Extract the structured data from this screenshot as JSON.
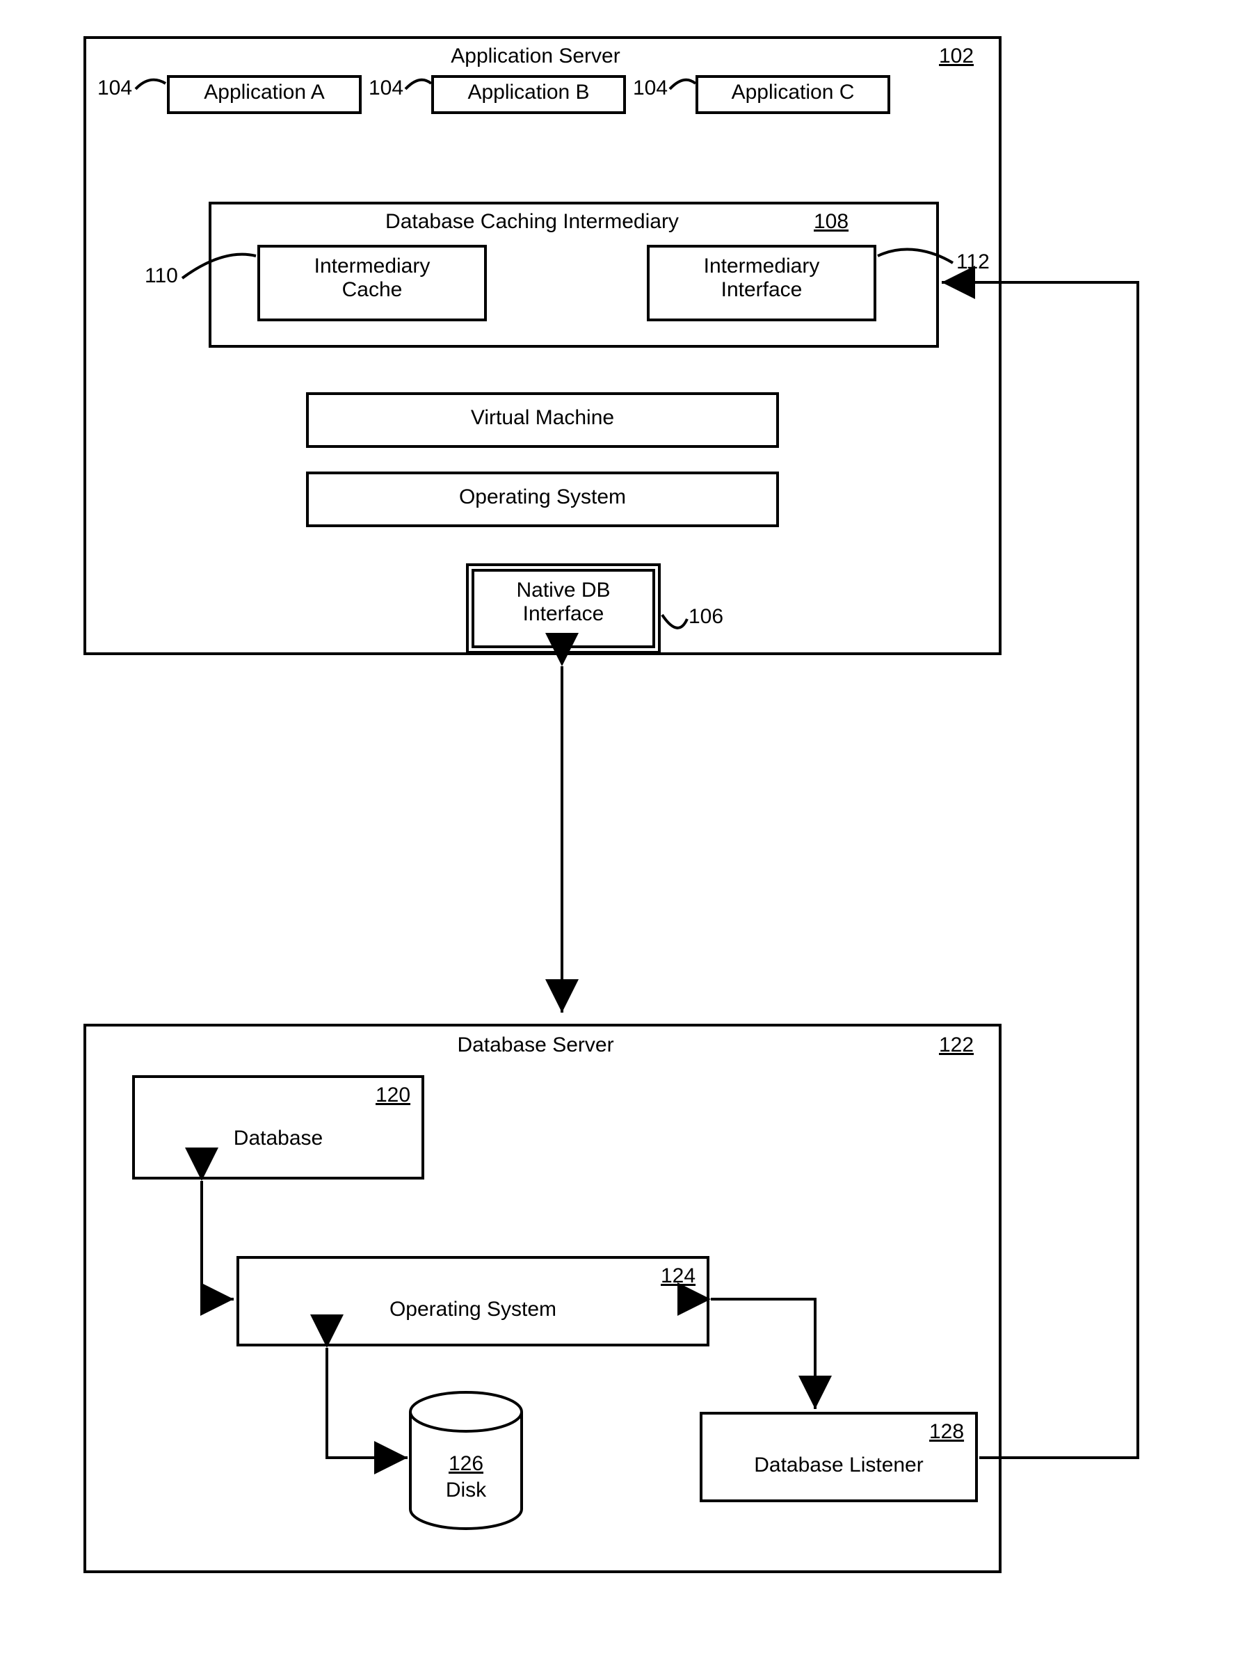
{
  "appServer": {
    "title": "Application Server",
    "ref": "102",
    "apps": {
      "a": "Application A",
      "b": "Application B",
      "c": "Application C",
      "refLabel": "104"
    },
    "dci": {
      "title": "Database Caching Intermediary",
      "ref": "108",
      "cache": {
        "label": "Intermediary\nCache",
        "ref": "110"
      },
      "iface": {
        "label": "Intermediary\nInterface",
        "ref": "112"
      }
    },
    "vm": "Virtual Machine",
    "os": "Operating System",
    "ndb": {
      "label": "Native DB\nInterface",
      "ref": "106"
    }
  },
  "dbServer": {
    "title": "Database Server",
    "ref": "122",
    "db": {
      "label": "Database",
      "ref": "120"
    },
    "os": {
      "label": "Operating System",
      "ref": "124"
    },
    "disk": {
      "label": "Disk",
      "ref": "126"
    },
    "listener": {
      "label": "Database Listener",
      "ref": "128"
    }
  }
}
